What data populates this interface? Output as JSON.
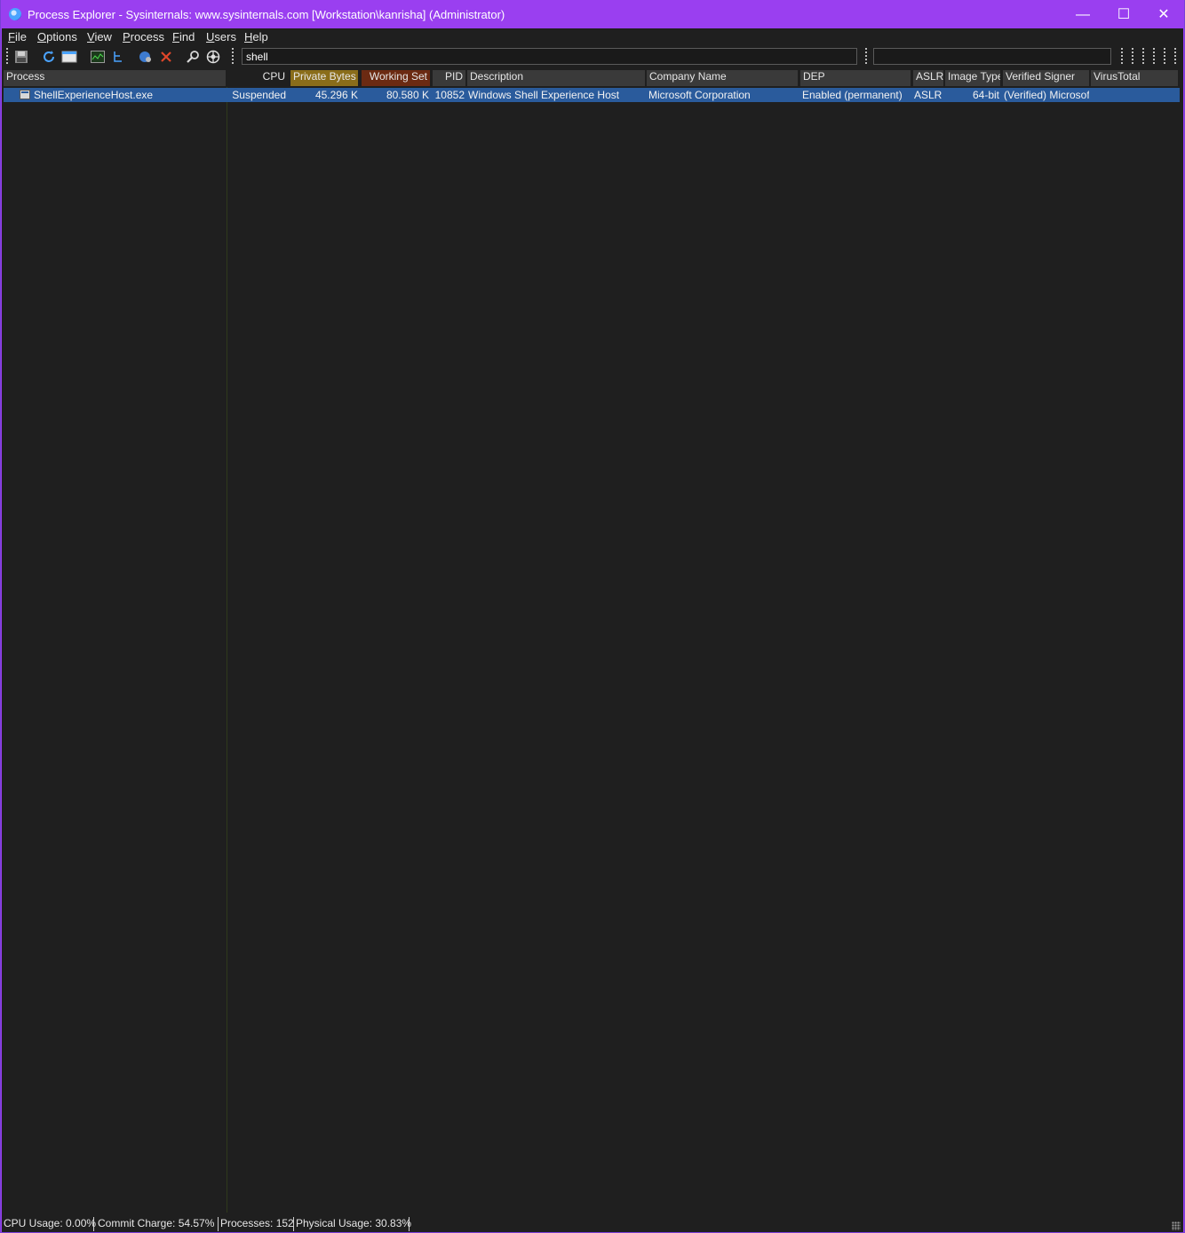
{
  "window": {
    "title": "Process Explorer - Sysinternals: www.sysinternals.com [Workstation\\kanrisha] (Administrator)"
  },
  "titlebar": {
    "minimize_glyph": "—",
    "maximize_glyph": "☐",
    "close_glyph": "✕"
  },
  "menu": [
    {
      "key": "F",
      "rest": "ile"
    },
    {
      "key": "O",
      "rest": "ptions"
    },
    {
      "key": "V",
      "rest": "iew"
    },
    {
      "key": "P",
      "rest": "rocess"
    },
    {
      "key": "F",
      "rest": "ind"
    },
    {
      "key": "U",
      "rest": "sers"
    },
    {
      "key": "H",
      "rest": "elp"
    }
  ],
  "toolbar": {
    "filter_value": "shell",
    "icons": [
      "save-icon",
      "refresh-icon",
      "system-info-icon",
      "cpu-graph-icon",
      "tree-view-icon",
      "dll-view-icon",
      "kill-process-icon",
      "find-icon",
      "target-icon"
    ]
  },
  "columns": {
    "process": "Process",
    "cpu": "CPU",
    "private_bytes": "Private Bytes",
    "working_set": "Working Set",
    "pid": "PID",
    "description": "Description",
    "company": "Company Name",
    "dep": "DEP",
    "aslr": "ASLR",
    "image_type": "Image Type",
    "verified_signer": "Verified Signer",
    "virustotal": "VirusTotal"
  },
  "column_colors": {
    "private_bytes": "#8a6d1a",
    "working_set": "#6b2a12",
    "selected_row": "#2a5b9c"
  },
  "rows": [
    {
      "process": "ShellExperienceHost.exe",
      "cpu": "Suspended",
      "private_bytes": "45.296 K",
      "working_set": "80.580 K",
      "pid": "10852",
      "description": "Windows Shell Experience Host",
      "company": "Microsoft Corporation",
      "dep": "Enabled (permanent)",
      "aslr": "ASLR",
      "image_type": "64-bit",
      "verified_signer": "(Verified) Microsoft...",
      "virustotal": ""
    }
  ],
  "status": {
    "cpu_usage": "CPU Usage: 0.00%",
    "commit_charge": "Commit Charge: 54.57%",
    "processes": "Processes: 152",
    "physical_usage": "Physical Usage: 30.83%"
  }
}
